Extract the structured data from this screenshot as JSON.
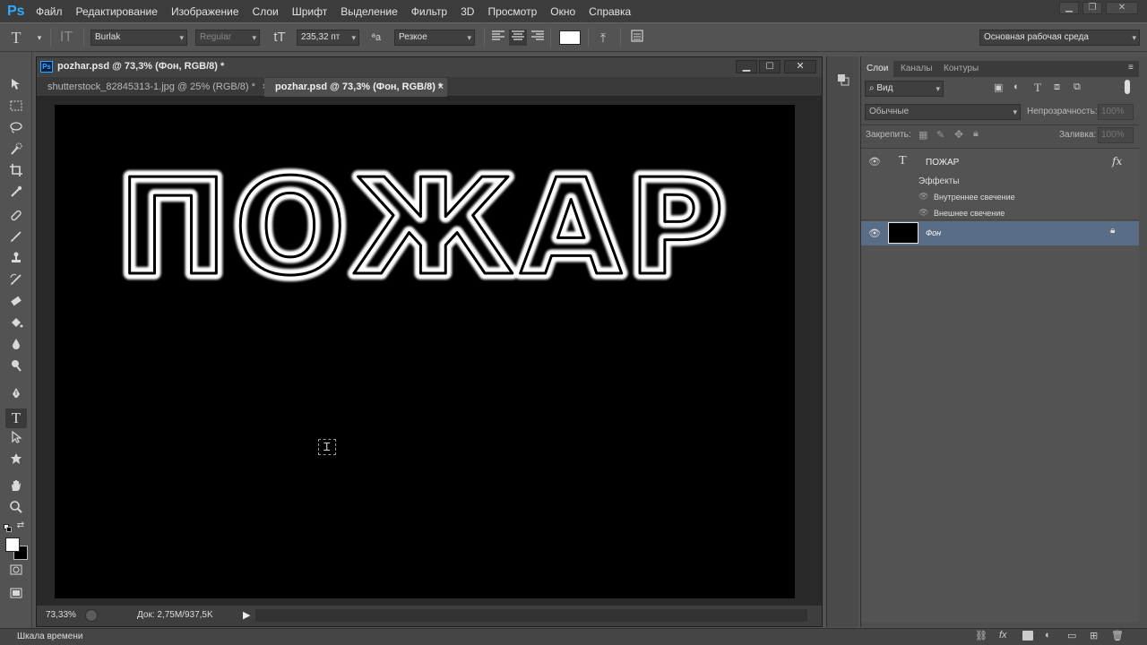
{
  "app": {
    "logo": "Ps",
    "menu": [
      "Файл",
      "Редактирование",
      "Изображение",
      "Слои",
      "Шрифт",
      "Выделение",
      "Фильтр",
      "3D",
      "Просмотр",
      "Окно",
      "Справка"
    ]
  },
  "options_bar": {
    "font_family": "Burlak",
    "font_style": "Regular",
    "font_size": "235,32 пт",
    "aa_label": "ªa",
    "antialias": "Резкое",
    "workspace": "Основная рабочая среда",
    "text_color": "#ffffff"
  },
  "document": {
    "window_title": "pozhar.psd @ 73,3% (Фон, RGB/8) *",
    "tabs": [
      {
        "label": "shutterstock_82845313-1.jpg @ 25% (RGB/8) *",
        "active": false
      },
      {
        "label": "pozhar.psd @ 73,3% (Фон, RGB/8) *",
        "active": true
      }
    ],
    "canvas_text": "ПОЖАР",
    "status": {
      "zoom": "73,33%",
      "doc_info": "Док: 2,75M/937,5K"
    }
  },
  "layers_panel": {
    "tabs": [
      "Слои",
      "Каналы",
      "Контуры"
    ],
    "filter_kind": "Вид",
    "blend_mode": "Обычные",
    "opacity_label": "Непрозрачность:",
    "opacity_value": "100%",
    "lock_label": "Закрепить:",
    "fill_label": "Заливка:",
    "fill_value": "100%",
    "layers": [
      {
        "name": "ПОЖАР",
        "type": "text",
        "fx": "fx",
        "effects_label": "Эффекты",
        "effects": [
          "Внутреннее свечение",
          "Внешнее свечение"
        ]
      },
      {
        "name": "Фон",
        "type": "background",
        "selected": true
      }
    ]
  },
  "timeline": {
    "label": "Шкала времени"
  },
  "colors": {
    "accent": "#31a8ff",
    "selected_layer": "#5a6d86",
    "canvas": "#000000"
  }
}
